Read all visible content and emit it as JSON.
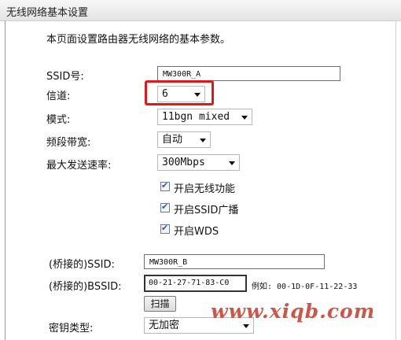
{
  "page_title": "无线网络基本设置",
  "intro": "本页面设置路由器无线网络的基本参数。",
  "form": {
    "ssid": {
      "label": "SSID号:",
      "value": "MW300R_A"
    },
    "channel": {
      "label": "信道:",
      "value": "6"
    },
    "mode": {
      "label": "模式:",
      "value": "11bgn mixed"
    },
    "bandwidth": {
      "label": "频段带宽:",
      "value": "自动"
    },
    "max_rate": {
      "label": "最大发送速率:",
      "value": "300Mbps"
    },
    "enable_wireless": {
      "label": "开启无线功能",
      "checked": true
    },
    "enable_ssid_broadcast": {
      "label": "开启SSID广播",
      "checked": true
    },
    "enable_wds": {
      "label": "开启WDS",
      "checked": true
    },
    "bridged_ssid": {
      "label": "(桥接的)SSID:",
      "value": "MW300R_B"
    },
    "bridged_bssid": {
      "label": "(桥接的)BSSID:",
      "value": "00-21-27-71-83-C0"
    },
    "bssid_example": "例如: 00-1D-0F-11-22-33",
    "scan_button": "扫描",
    "key_type": {
      "label": "密钥类型:",
      "value": "无加密"
    }
  },
  "watermark": "www.xiqb.com",
  "colors": {
    "highlight": "#e01818",
    "watermark": "#c43a2a",
    "check": "#1a5fc9"
  },
  "icons": {
    "dropdown": "chevron-down-icon",
    "checkmark": "checkmark-icon"
  }
}
